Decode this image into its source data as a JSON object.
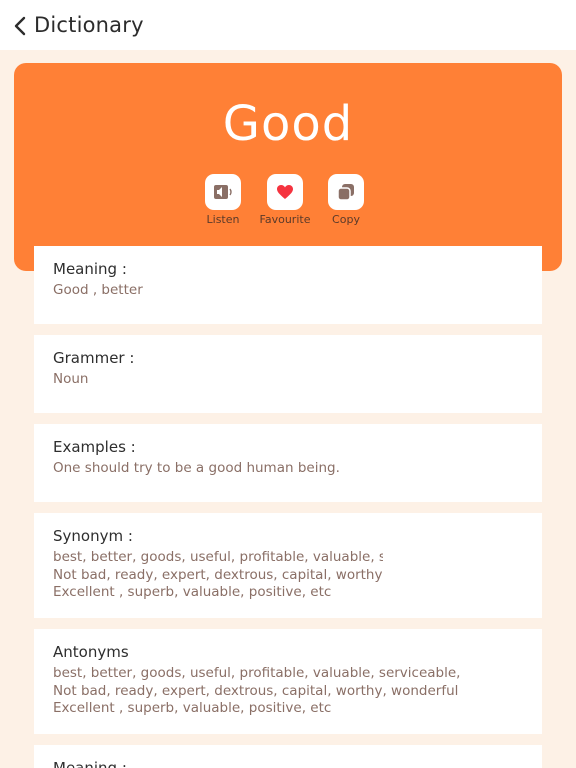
{
  "header": {
    "title": "Dictionary"
  },
  "word": "Good",
  "actions": {
    "listen": "Listen",
    "favourite": "Favourite",
    "copy": "Copy"
  },
  "sections": {
    "meaning": {
      "title": "Meaning :",
      "text": "Good , better"
    },
    "grammer": {
      "title": "Grammer :",
      "text": "Noun"
    },
    "examples": {
      "title": "Examples :",
      "text": "One should try to be a good human being."
    },
    "synonym": {
      "title": "Synonym :",
      "lines": [
        "best, better, goods, useful, profitable, valuable, serviceable,",
        "Not bad, ready, expert, dextrous, capital, worthy, wonderful",
        "Excellent , superb, valuable, positive, etc"
      ]
    },
    "antonyms": {
      "title": "Antonyms",
      "lines": [
        "best, better, goods, useful, profitable, valuable, serviceable,",
        "Not bad, ready, expert, dextrous, capital, worthy, wonderful",
        "Excellent , superb, valuable, positive, etc"
      ]
    },
    "meaning2": {
      "title": "Meaning :"
    }
  },
  "colors": {
    "accent": "#ff8036",
    "background": "#fdf1e6",
    "heart": "#f5333f",
    "icon": "#8a6f66"
  }
}
